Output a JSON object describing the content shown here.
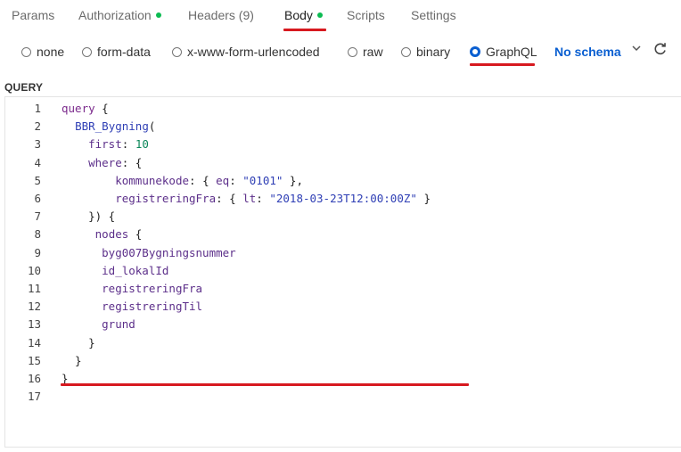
{
  "tabs": [
    {
      "label": "Params",
      "dot": false,
      "active": false
    },
    {
      "label": "Authorization",
      "dot": true,
      "active": false
    },
    {
      "label": "Headers (9)",
      "dot": false,
      "active": false
    },
    {
      "label": "Body",
      "dot": true,
      "active": true
    },
    {
      "label": "Scripts",
      "dot": false,
      "active": false
    },
    {
      "label": "Settings",
      "dot": false,
      "active": false
    }
  ],
  "body_types": [
    {
      "label": "none",
      "selected": false
    },
    {
      "label": "form-data",
      "selected": false
    },
    {
      "label": "x-www-form-urlencoded",
      "selected": false
    },
    {
      "label": "raw",
      "selected": false
    },
    {
      "label": "binary",
      "selected": false
    },
    {
      "label": "GraphQL",
      "selected": true
    }
  ],
  "schema_label": "No schema",
  "section_label": "QUERY",
  "icons": {
    "schema_dropdown": "chevron-down-icon",
    "refresh": "refresh-icon"
  },
  "colors": {
    "accent": "#0a5fd1",
    "status_dot": "#0cbb52",
    "annotation_underline": "#d7191f"
  },
  "editor": {
    "line_numbers": [
      "1",
      "2",
      "3",
      "4",
      "5",
      "6",
      "7",
      "8",
      "9",
      "10",
      "11",
      "12",
      "13",
      "14",
      "15",
      "16",
      "17"
    ],
    "lines": [
      [
        [
          "kw",
          "query"
        ],
        [
          "p",
          " {"
        ]
      ],
      [
        [
          "p",
          "  "
        ],
        [
          "fn",
          "BBR_Bygning"
        ],
        [
          "p",
          "("
        ]
      ],
      [
        [
          "p",
          "    "
        ],
        [
          "fld",
          "first"
        ],
        [
          "p",
          ": "
        ],
        [
          "num",
          "10"
        ]
      ],
      [
        [
          "p",
          "    "
        ],
        [
          "fld",
          "where"
        ],
        [
          "p",
          ": {"
        ]
      ],
      [
        [
          "p",
          "        "
        ],
        [
          "fld",
          "kommunekode"
        ],
        [
          "p",
          ": { "
        ],
        [
          "fld",
          "eq"
        ],
        [
          "p",
          ": "
        ],
        [
          "str",
          "\"0101\""
        ],
        [
          "p",
          " },"
        ]
      ],
      [
        [
          "p",
          "        "
        ],
        [
          "fld",
          "registreringFra"
        ],
        [
          "p",
          ": { "
        ],
        [
          "fld",
          "lt"
        ],
        [
          "p",
          ": "
        ],
        [
          "str",
          "\"2018-03-23T12:00:00Z\""
        ],
        [
          "p",
          " }"
        ]
      ],
      [
        [
          "p",
          "    }) {"
        ]
      ],
      [
        [
          "p",
          "     "
        ],
        [
          "fld",
          "nodes"
        ],
        [
          "p",
          " {"
        ]
      ],
      [
        [
          "p",
          "      "
        ],
        [
          "fld",
          "byg007Bygningsnummer"
        ]
      ],
      [
        [
          "p",
          "      "
        ],
        [
          "fld",
          "id_lokalId"
        ]
      ],
      [
        [
          "p",
          "      "
        ],
        [
          "fld",
          "registreringFra"
        ]
      ],
      [
        [
          "p",
          "      "
        ],
        [
          "fld",
          "registreringTil"
        ]
      ],
      [
        [
          "p",
          "      "
        ],
        [
          "fld",
          "grund"
        ]
      ],
      [
        [
          "p",
          "    }"
        ]
      ],
      [
        [
          "p",
          "  }"
        ]
      ],
      [
        [
          "p",
          "}"
        ]
      ],
      []
    ]
  }
}
